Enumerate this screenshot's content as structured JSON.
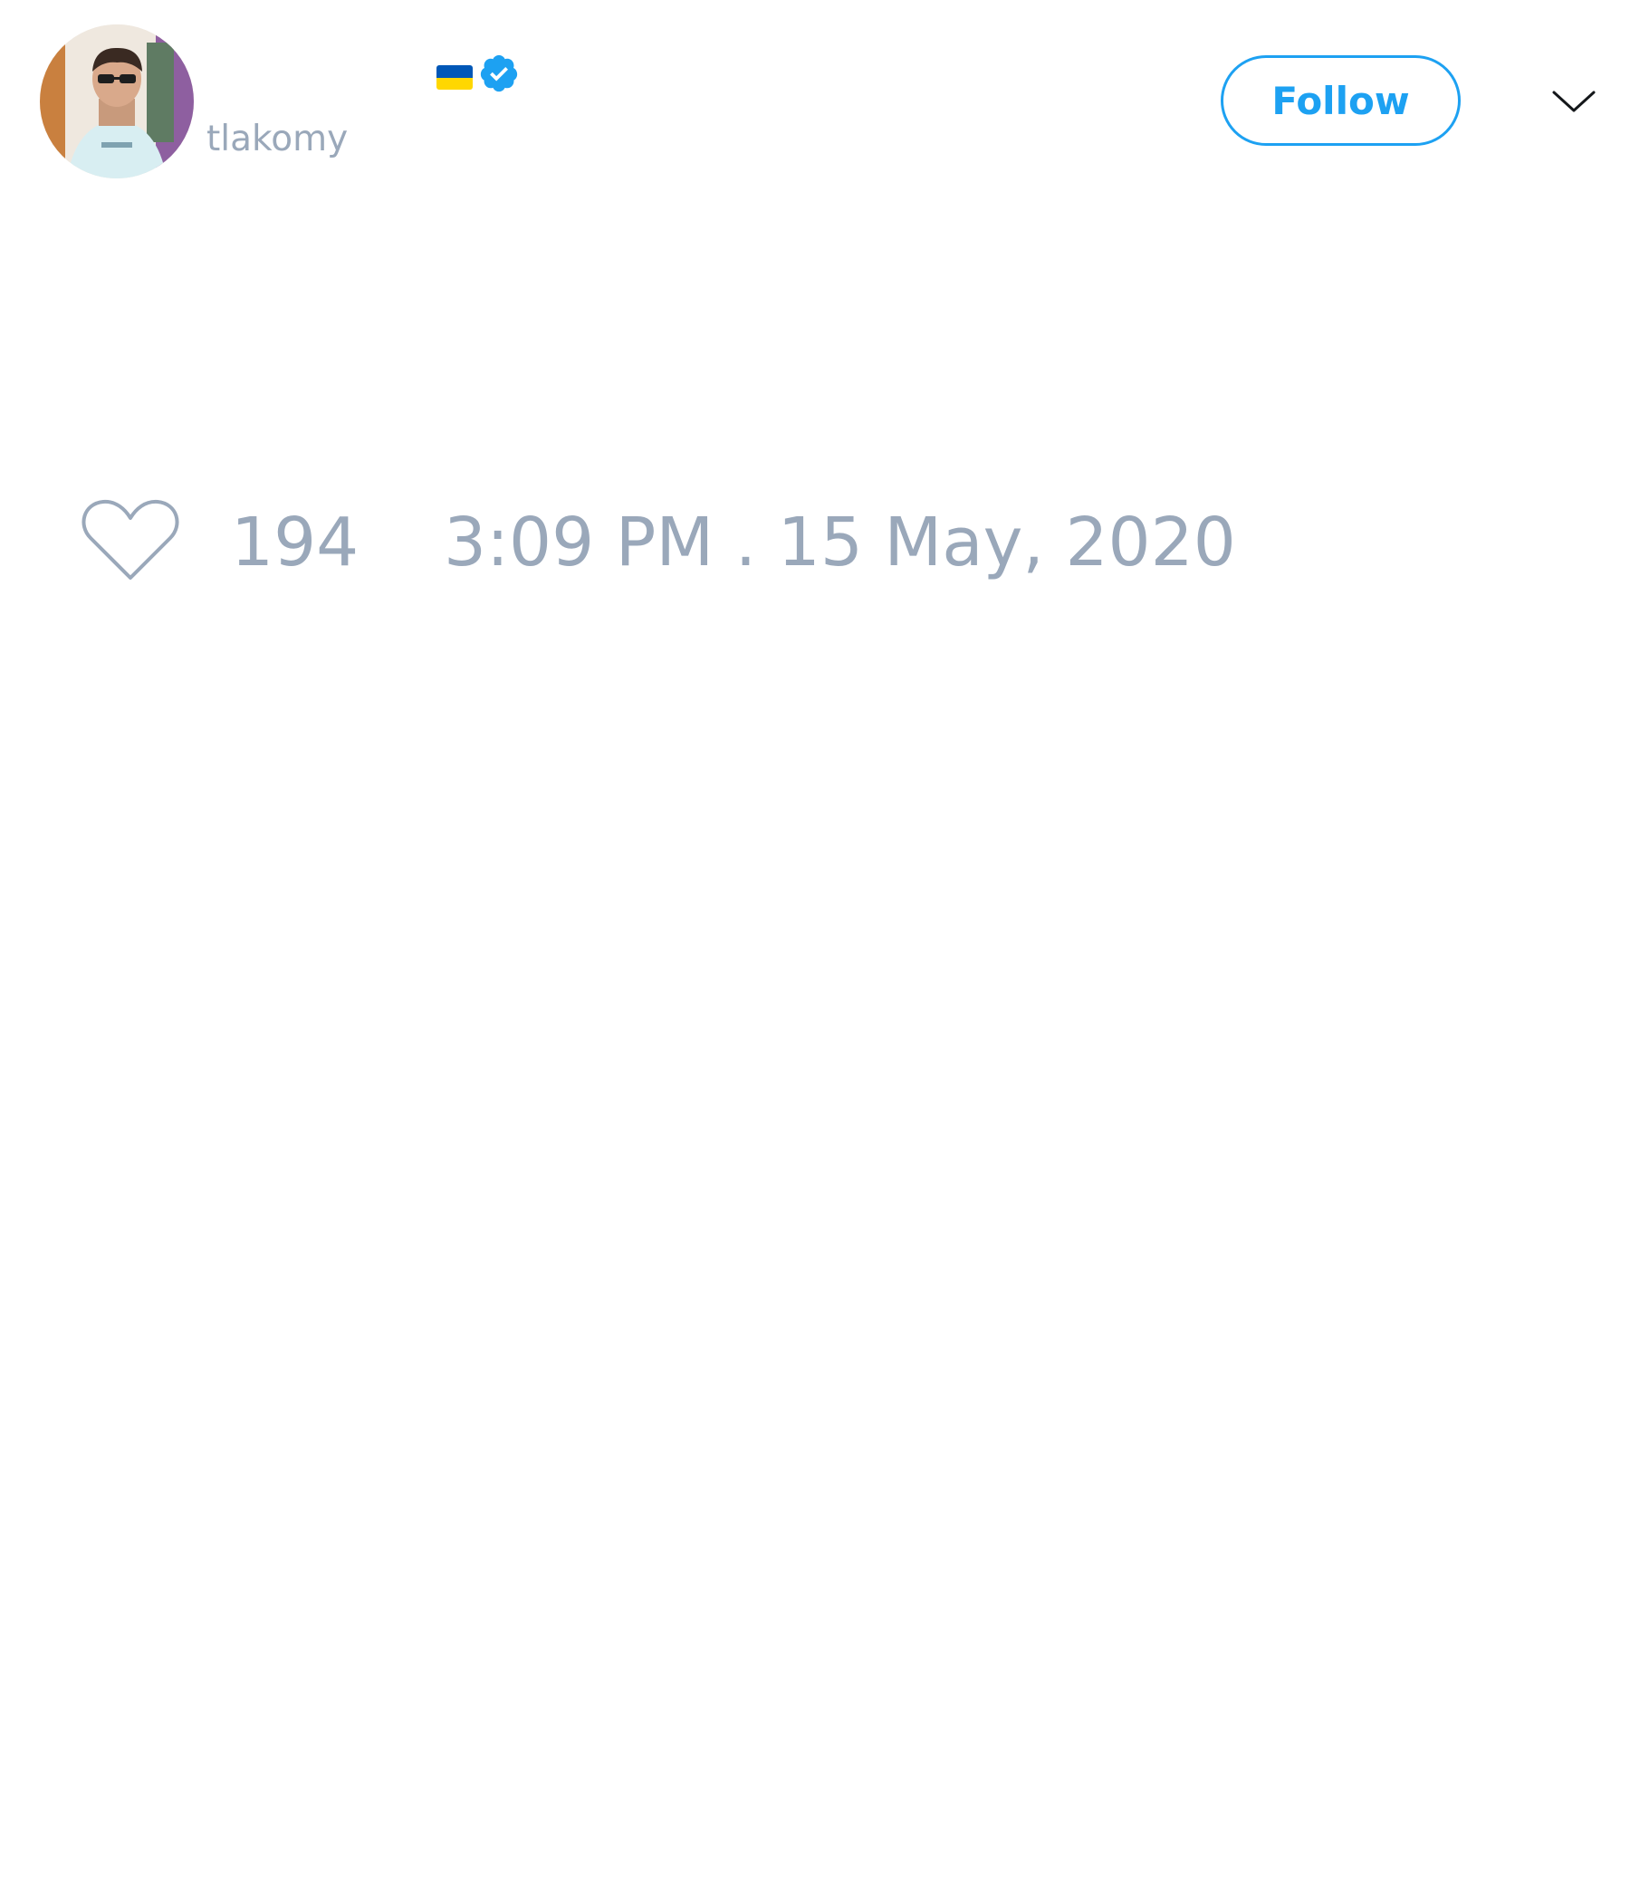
{
  "tweet": {
    "author": {
      "handle": "tlakomy",
      "flag": "ukraine-flag",
      "verified_icon": "verified-badge-icon"
    },
    "follow_label": "Follow",
    "menu_icon": "chevron-down-icon",
    "like_icon": "heart-icon",
    "likes": "194",
    "timestamp": "3:09 PM . 15 May, 2020"
  },
  "colors": {
    "accent": "#1da1f2",
    "muted_text": "#9aa8ba",
    "flag_blue": "#0057b7",
    "flag_yellow": "#ffd700",
    "background": "#ffffff"
  }
}
